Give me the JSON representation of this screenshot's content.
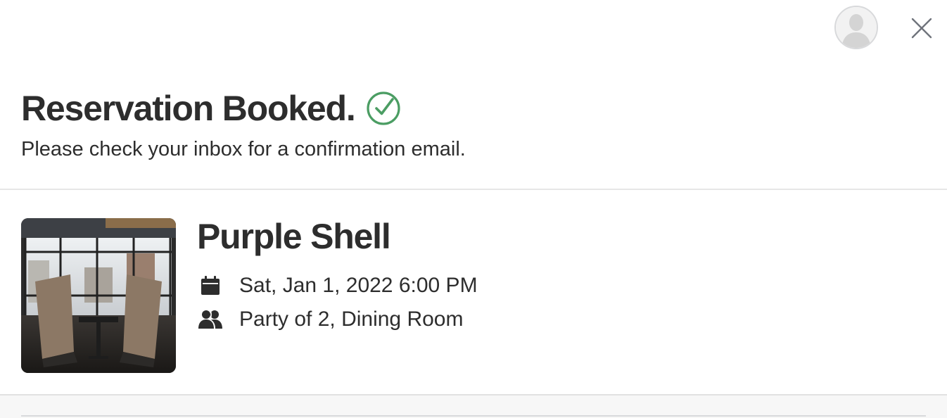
{
  "header": {
    "title": "Reservation Booked.",
    "subtitle": "Please check your inbox for a confirmation email."
  },
  "icons": {
    "avatar": "user-avatar-icon",
    "close": "close-icon",
    "success": "check-circle-icon",
    "date": "calendar-icon",
    "party": "people-icon"
  },
  "reservation": {
    "restaurant_name": "Purple Shell",
    "datetime": "Sat, Jan 1, 2022 6:00 PM",
    "party": "Party of 2, Dining Room"
  },
  "colors": {
    "success_green": "#4b9d63",
    "text": "#2d2d2d",
    "divider": "#e6e6e6"
  }
}
